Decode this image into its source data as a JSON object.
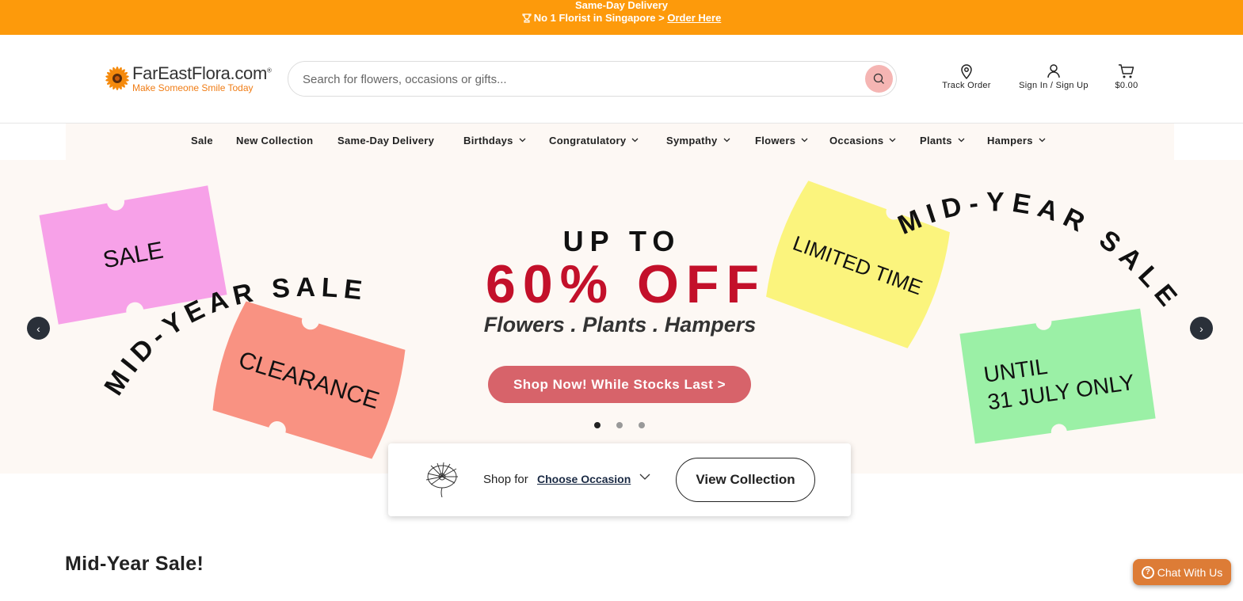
{
  "topbar": {
    "line1": "Same-Day Delivery",
    "line2_prefix": "No 1 Florist in Singapore >",
    "line2_link": "Order Here",
    "bg_color": "#fd9a0b"
  },
  "header": {
    "logo_name": "FarEastFlora.com",
    "logo_reg": "®",
    "logo_tagline": "Make Someone Smile Today",
    "search_placeholder": "Search for flowers, occasions or gifts...",
    "track_order": "Track Order",
    "sign_in": "Sign In / Sign Up",
    "cart_total": "$0.00"
  },
  "nav": {
    "items": [
      {
        "label": "Sale",
        "dropdown": false
      },
      {
        "label": "New Collection",
        "dropdown": false
      },
      {
        "label": "Same-Day Delivery",
        "dropdown": false
      },
      {
        "label": "Birthdays",
        "dropdown": true
      },
      {
        "label": "Congratulatory",
        "dropdown": true
      },
      {
        "label": "Sympathy",
        "dropdown": true
      },
      {
        "label": "Flowers",
        "dropdown": true
      },
      {
        "label": "Occasions",
        "dropdown": true
      },
      {
        "label": "Plants",
        "dropdown": true
      },
      {
        "label": "Hampers",
        "dropdown": true
      }
    ]
  },
  "hero": {
    "tag_sale": "SALE",
    "tag_clearance": "CLEARANCE",
    "tag_limited": "LIMITED TIME",
    "tag_until_1": "UNTIL",
    "tag_until_2": "31 JULY ONLY",
    "arc_text": "MID-YEAR SALE",
    "up_to": "UP TO",
    "discount": "60% OFF",
    "categories": "Flowers . Plants . Hampers",
    "cta": "Shop Now! While Stocks Last >",
    "slide_count": 3,
    "active_slide": 1,
    "prev_arrow": "‹",
    "next_arrow": "›",
    "colors": {
      "discount": "#c3102a",
      "cta": "#d7636a",
      "sale_tag": "#f7a1e8",
      "clearance_tag": "#f99282",
      "limited_tag": "#fbf47d",
      "until_tag": "#9bf0a6"
    }
  },
  "finder": {
    "shop_for": "Shop for",
    "occasion": "Choose Occasion",
    "view_collection": "View Collection"
  },
  "section": {
    "title": "Mid-Year Sale!"
  },
  "chat": {
    "icon": "?",
    "label": "Chat With Us"
  }
}
